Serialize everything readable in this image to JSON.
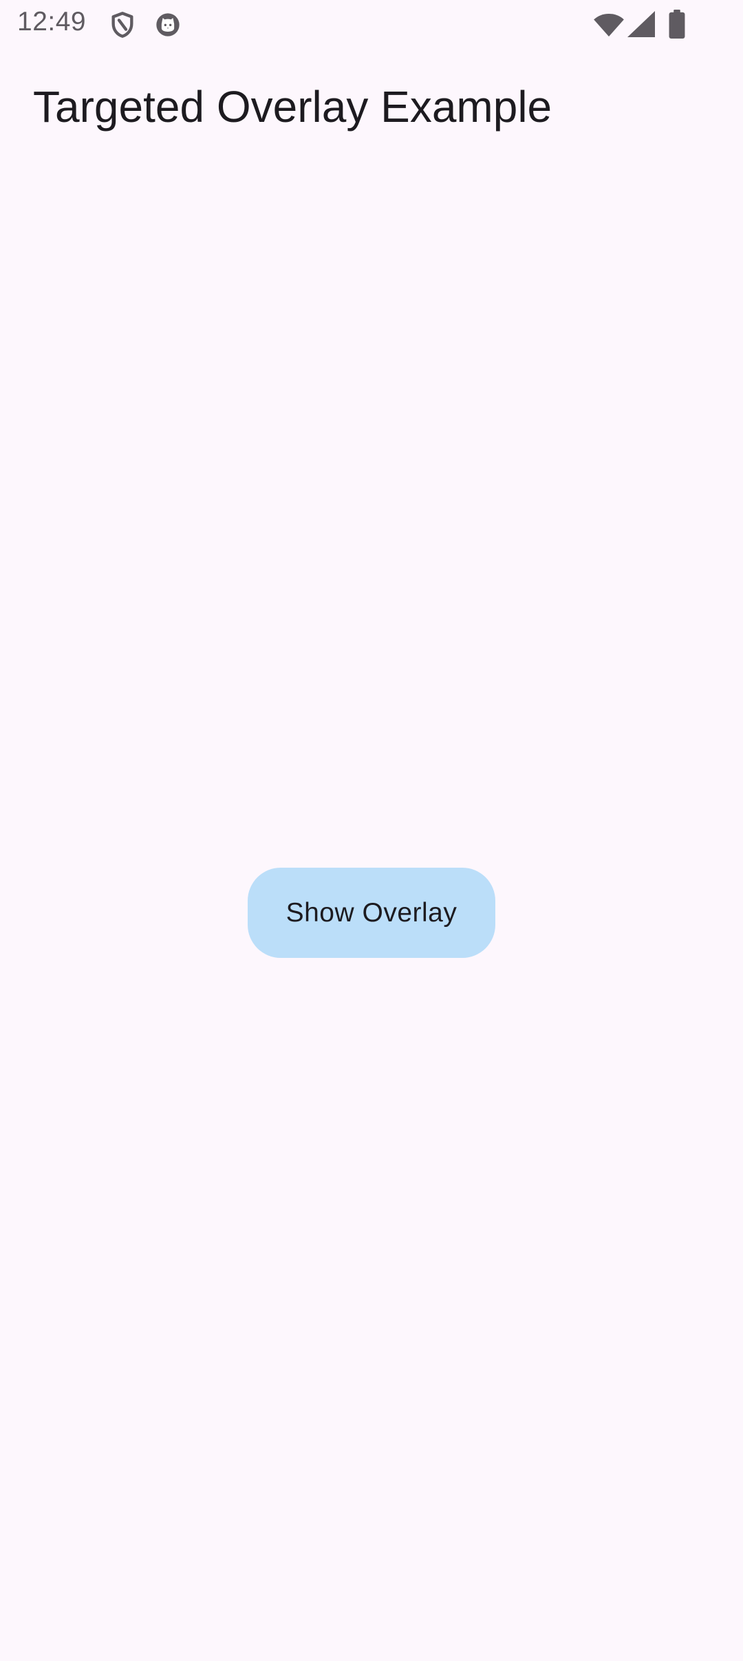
{
  "status_bar": {
    "time": "12:49",
    "icons": [
      "shield-icon",
      "cat-icon",
      "wifi-icon",
      "signal-icon",
      "battery-icon"
    ],
    "icon_color": "#5f5b61"
  },
  "app_bar": {
    "title": "Targeted Overlay Example"
  },
  "main": {
    "button_label": "Show Overlay"
  },
  "colors": {
    "background": "#FDF7FD",
    "button_background": "#BBDEF9",
    "text": "#1d1b20"
  }
}
